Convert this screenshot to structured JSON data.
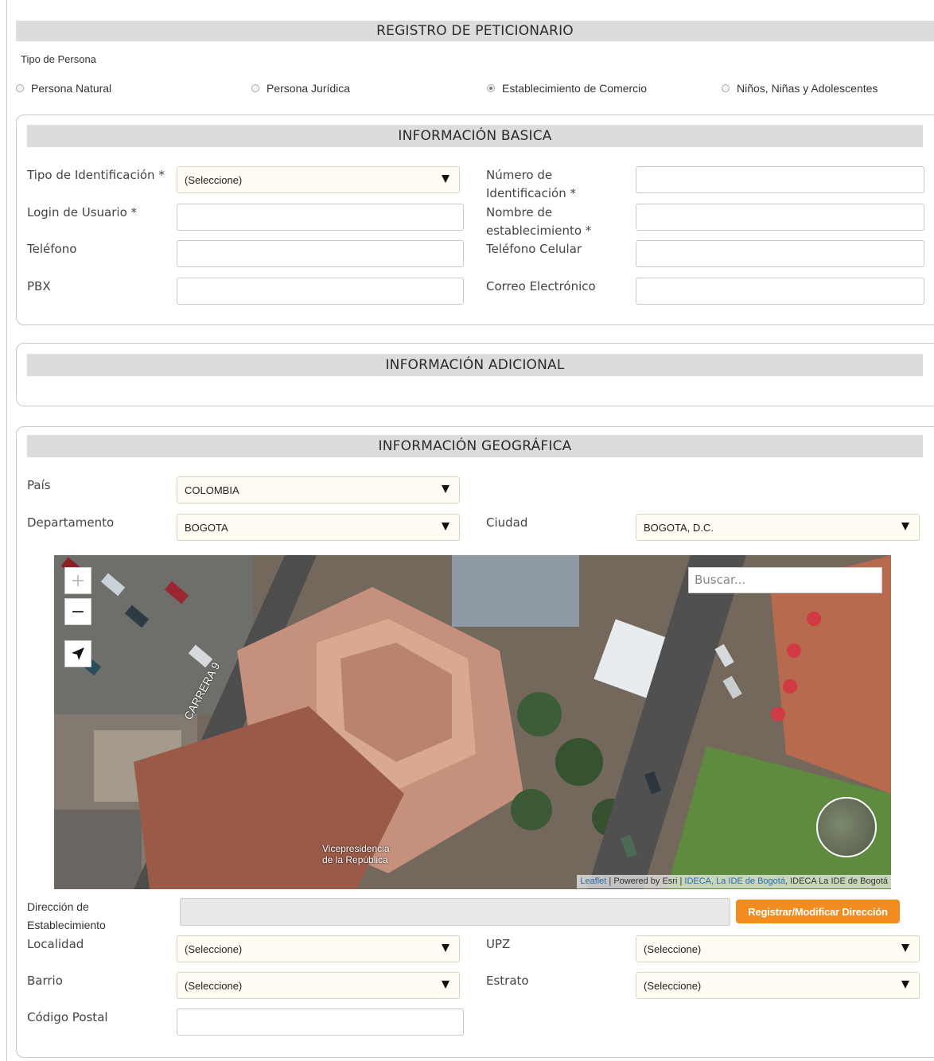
{
  "header": {
    "title": "REGISTRO DE PETICIONARIO"
  },
  "tipo_persona": {
    "label": "Tipo de Persona",
    "options": [
      {
        "label": "Persona Natural",
        "selected": false
      },
      {
        "label": "Persona Jurídica",
        "selected": false
      },
      {
        "label": "Establecimiento de Comercio",
        "selected": true
      },
      {
        "label": "Niños, Niñas y Adolescentes",
        "selected": false
      }
    ]
  },
  "basica": {
    "title": "INFORMACIÓN BASICA",
    "tipo_id_label": "Tipo de Identificación *",
    "tipo_id_value": "(Seleccione)",
    "numero_id_label": "Número de Identificación *",
    "login_label": "Login de Usuario *",
    "nombre_label": "Nombre de establecimiento *",
    "telefono_label": "Teléfono",
    "celular_label": "Teléfono Celular",
    "pbx_label": "PBX",
    "correo_label": "Correo Electrónico"
  },
  "adicional": {
    "title": "INFORMACIÓN ADICIONAL"
  },
  "geografica": {
    "title": "INFORMACIÓN GEOGRÁFICA",
    "pais_label": "País",
    "pais_value": "COLOMBIA",
    "depto_label": "Departamento",
    "depto_value": "BOGOTA",
    "ciudad_label": "Ciudad",
    "ciudad_value": "BOGOTA, D.C.",
    "map": {
      "zoom_in": "+",
      "zoom_out": "−",
      "search_placeholder": "Buscar...",
      "street_label": "CARRERA 9",
      "place_label_1": "Vicepresidencia",
      "place_label_2": "de la República",
      "attribution_leaflet": "Leaflet",
      "attribution_rest": " | Powered by Esri | ",
      "attribution_ideca": "IDECA, La IDE de Bogotá",
      "attribution_tail": ", IDECA La IDE de Bogotá"
    },
    "direccion_label": "Dirección de Establecimiento",
    "registrar_button": "Registrar/Modificar Dirección",
    "localidad_label": "Localidad",
    "localidad_value": "(Seleccione)",
    "upz_label": "UPZ",
    "upz_value": "(Seleccione)",
    "barrio_label": "Barrio",
    "barrio_value": "(Seleccione)",
    "estrato_label": "Estrato",
    "estrato_value": "(Seleccione)",
    "postal_label": "Código Postal"
  },
  "colors": {
    "accent_button": "#f28c1e",
    "section_bar": "#dcdcdc",
    "select_bg": "#fffdf3"
  }
}
